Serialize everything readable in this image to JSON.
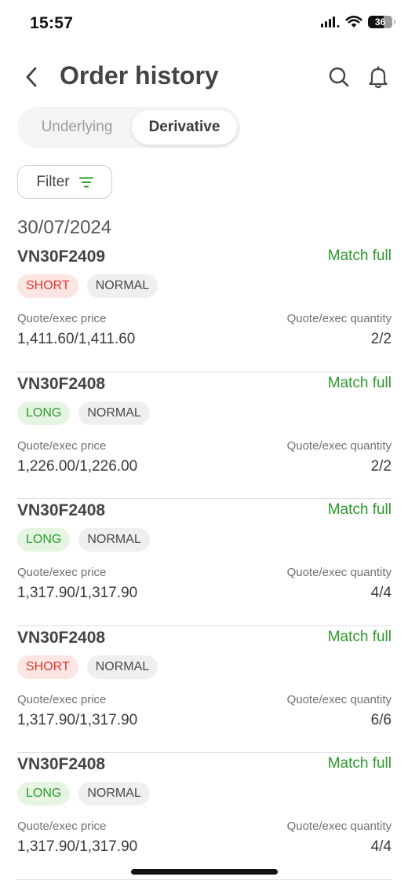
{
  "status_bar": {
    "time": "15:57",
    "battery_level": "36",
    "icons": [
      "cellular-signal-icon",
      "wifi-icon",
      "battery-icon"
    ]
  },
  "header": {
    "title": "Order history",
    "icons": [
      "back-chevron-icon",
      "search-icon",
      "bell-icon"
    ]
  },
  "tabs": {
    "items": [
      "Underlying",
      "Derivative"
    ],
    "selected": "Derivative"
  },
  "filter": {
    "label": "Filter",
    "icon": "filter-icon"
  },
  "date": "30/07/2024",
  "labels": {
    "price": "Quote/exec price",
    "quantity": "Quote/exec quantity"
  },
  "orders": [
    {
      "symbol": "VN30F2409",
      "status": "Match full",
      "side": "SHORT",
      "type": "NORMAL",
      "price": "1,411.60/1,411.60",
      "quantity": "2/2"
    },
    {
      "symbol": "VN30F2408",
      "status": "Match full",
      "side": "LONG",
      "type": "NORMAL",
      "price": "1,226.00/1,226.00",
      "quantity": "2/2"
    },
    {
      "symbol": "VN30F2408",
      "status": "Match full",
      "side": "LONG",
      "type": "NORMAL",
      "price": "1,317.90/1,317.90",
      "quantity": "4/4"
    },
    {
      "symbol": "VN30F2408",
      "status": "Match full",
      "side": "SHORT",
      "type": "NORMAL",
      "price": "1,317.90/1,317.90",
      "quantity": "6/6"
    },
    {
      "symbol": "VN30F2408",
      "status": "Match full",
      "side": "LONG",
      "type": "NORMAL",
      "price": "1,317.90/1,317.90",
      "quantity": "4/4"
    }
  ],
  "colors": {
    "match_green": "#2c9a2c",
    "short_red": "#d83a2c",
    "short_bg": "#fde5e4",
    "long_bg": "#e6f5e2"
  }
}
